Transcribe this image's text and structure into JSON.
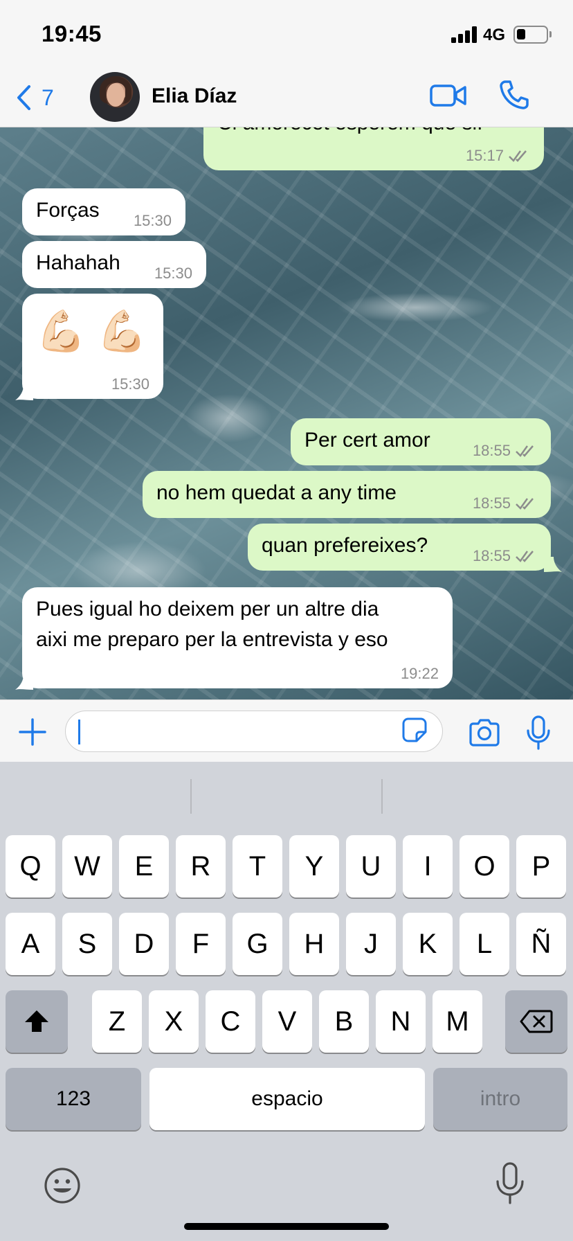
{
  "status_bar": {
    "time": "19:45",
    "network": "4G",
    "battery_level": 0.3
  },
  "header": {
    "back_count": "7",
    "contact_name": "Elia Díaz",
    "avatar_icon": "contact-photo"
  },
  "colors": {
    "accent": "#1f7ae8",
    "outgoing_bubble": "#dcf8c7",
    "incoming_bubble": "#ffffff",
    "read_tick": "#8c8c8c"
  },
  "messages": [
    {
      "direction": "out",
      "text": "Ci amorecet esperem que si.",
      "time": "15:17",
      "status": "read"
    },
    {
      "direction": "in",
      "text": "Forças",
      "time": "15:30"
    },
    {
      "direction": "in",
      "text": "Hahahah",
      "time": "15:30"
    },
    {
      "direction": "in",
      "text": "💪🏻 💪🏻",
      "time": "15:30"
    },
    {
      "direction": "out",
      "text": "Per cert amor",
      "time": "18:55",
      "status": "read"
    },
    {
      "direction": "out",
      "text": "no hem quedat a any time",
      "time": "18:55",
      "status": "read"
    },
    {
      "direction": "out",
      "text": "quan prefereixes?",
      "time": "18:55",
      "status": "read"
    },
    {
      "direction": "in",
      "text": "Pues igual ho deixem per un altre dia\naixi me preparo per la entrevista y eso",
      "time": "19:22"
    }
  ],
  "input": {
    "value": "",
    "placeholder": ""
  },
  "keyboard": {
    "row1": [
      "Q",
      "W",
      "E",
      "R",
      "T",
      "Y",
      "U",
      "I",
      "O",
      "P"
    ],
    "row2": [
      "A",
      "S",
      "D",
      "F",
      "G",
      "H",
      "J",
      "K",
      "L",
      "Ñ"
    ],
    "row3": [
      "Z",
      "X",
      "C",
      "V",
      "B",
      "N",
      "M"
    ],
    "numbers_key": "123",
    "space_key": "espacio",
    "return_key": "intro"
  }
}
